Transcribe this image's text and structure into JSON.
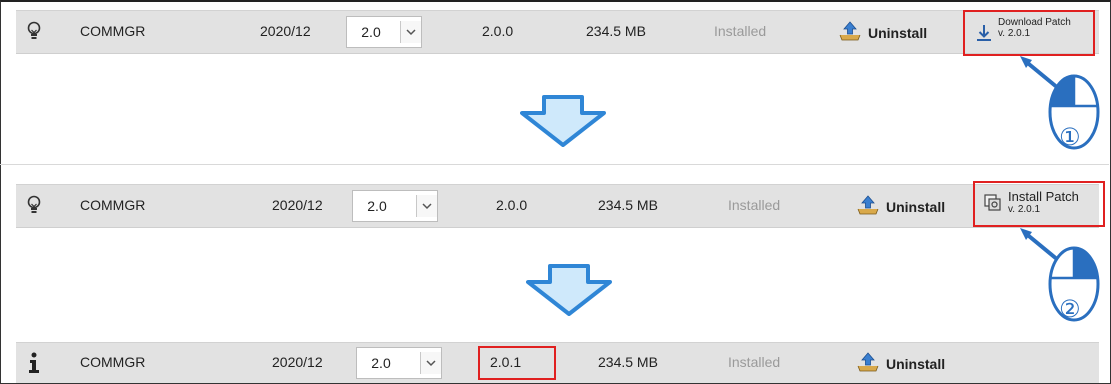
{
  "rows": [
    {
      "icon": "lightbulb-icon",
      "name": "COMMGR",
      "date": "2020/12",
      "select_value": "2.0",
      "version": "2.0.0",
      "size": "234.5 MB",
      "status": "Installed",
      "uninstall_label": "Uninstall",
      "patch_label": "Download Patch",
      "patch_version": "v. 2.0.1"
    },
    {
      "icon": "lightbulb-icon",
      "name": "COMMGR",
      "date": "2020/12",
      "select_value": "2.0",
      "version": "2.0.0",
      "size": "234.5 MB",
      "status": "Installed",
      "uninstall_label": "Uninstall",
      "patch_label": "Install Patch",
      "patch_version": "v. 2.0.1"
    },
    {
      "icon": "info-icon",
      "name": "COMMGR",
      "date": "2020/12",
      "select_value": "2.0",
      "version": "2.0.1",
      "size": "234.5 MB",
      "status": "Installed",
      "uninstall_label": "Uninstall"
    }
  ],
  "callouts": [
    {
      "step": "①"
    },
    {
      "step": "②"
    }
  ],
  "colors": {
    "highlight": "#e02020",
    "arrow_fill": "#cfe9fb",
    "arrow_stroke": "#2f86d6",
    "mouse_stroke": "#2a6fbf"
  }
}
